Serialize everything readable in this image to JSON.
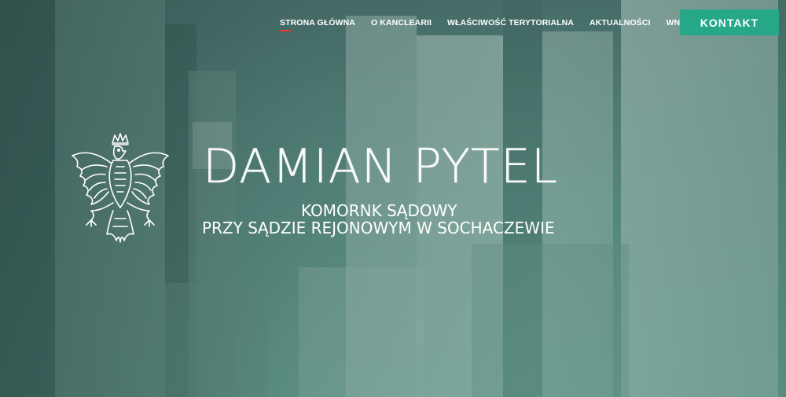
{
  "nav": {
    "items": [
      {
        "label": "STRONA GŁÓWNA",
        "active": true
      },
      {
        "label": "O KANCLEARII",
        "active": false
      },
      {
        "label": "WŁAŚCIWOŚĆ TERYTORIALNA",
        "active": false
      },
      {
        "label": "AKTUALNOŚCI",
        "active": false
      },
      {
        "label": "WNIOSKI",
        "active": false
      }
    ],
    "contact_label": "KONTAKT"
  },
  "hero": {
    "name": "DAMIAN PYTEL",
    "subtitle_line1": "KOMORNK SĄDOWY",
    "subtitle_line2": "PRZY SĄDZIE REJONOWYM W SOCHACZEWIE",
    "emblem_icon": "white-eagle-emblem-icon"
  },
  "colors": {
    "accent": "#26a888",
    "active_underline": "#e53935",
    "text": "#ffffff"
  }
}
